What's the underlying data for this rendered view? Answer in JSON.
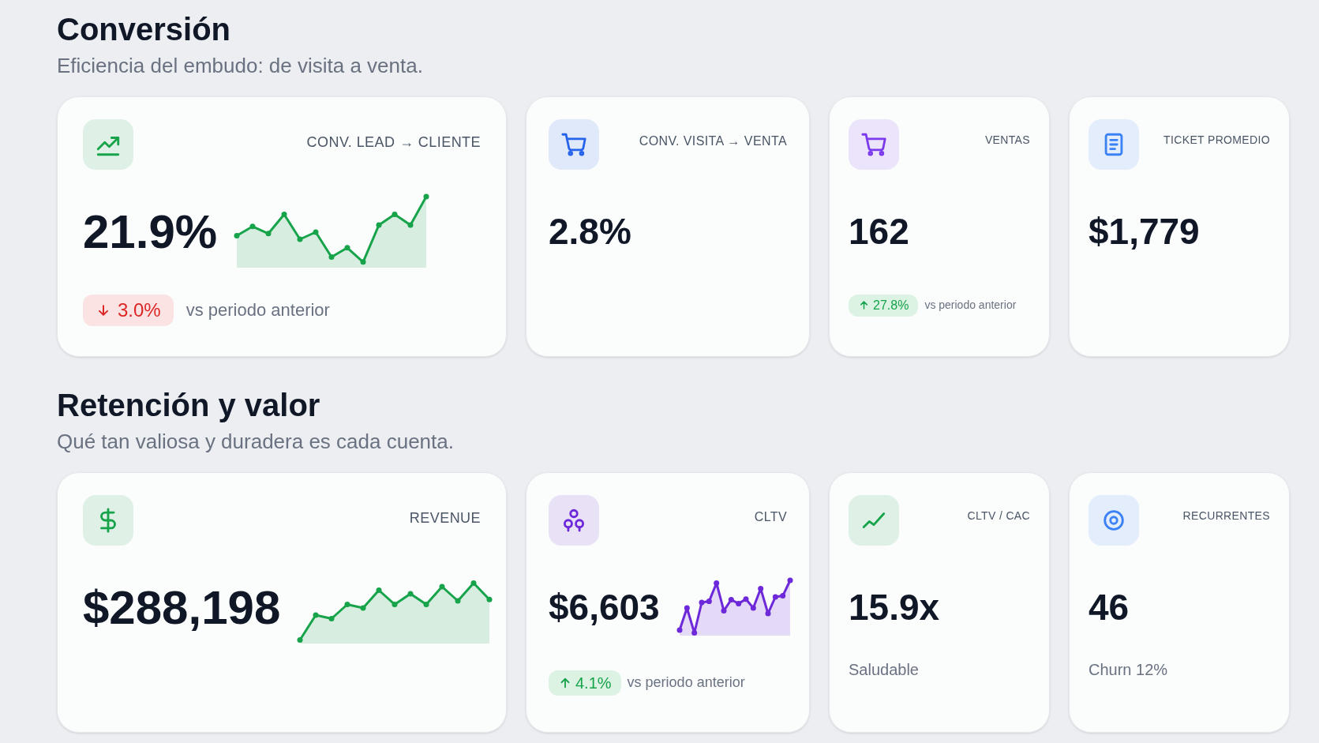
{
  "sections": [
    {
      "title": "Conversión",
      "subtitle": "Eficiencia del embudo: de visita a venta.",
      "cards": [
        {
          "kind": "sparkline",
          "color": "#16a34a",
          "label": "CONV. LEAD → CLIENTE",
          "value": "21.9%",
          "trend": {
            "kind": "down",
            "text": "3.0%"
          },
          "comparison": "vs periodo anterior"
        },
        {
          "kind": "plain",
          "color": "#2563eb",
          "label": "CONV. VISITA → VENTA",
          "value": "2.8%"
        },
        {
          "kind": "plain",
          "color": "#7c3aed",
          "label": "VENTAS",
          "value": "162",
          "trend": {
            "kind": "up",
            "text": "27.8%"
          },
          "comparison": "vs periodo anterior"
        },
        {
          "kind": "plain",
          "color": "#3b82f6",
          "label": "TICKET PROMEDIO",
          "value": "$1,779"
        }
      ]
    },
    {
      "title": "Retención y valor",
      "subtitle": "Qué tan valiosa y duradera es cada cuenta.",
      "cards": [
        {
          "kind": "sparkline",
          "color": "#16a34a",
          "label": "REVENUE",
          "value": "$288,198"
        },
        {
          "kind": "sparkline",
          "color": "#6d28d9",
          "label": "CLTV",
          "value": "$6,603",
          "trend": {
            "kind": "up",
            "text": "4.1%"
          },
          "comparison": "vs periodo anterior"
        },
        {
          "kind": "plain",
          "color": "#16a34a",
          "label": "CLTV / CAC",
          "value": "15.9x",
          "note": "Saludable"
        },
        {
          "kind": "plain",
          "color": "#3b82f6",
          "label": "RECURRENTES",
          "value": "46",
          "note": "Churn 12%"
        }
      ]
    }
  ]
}
